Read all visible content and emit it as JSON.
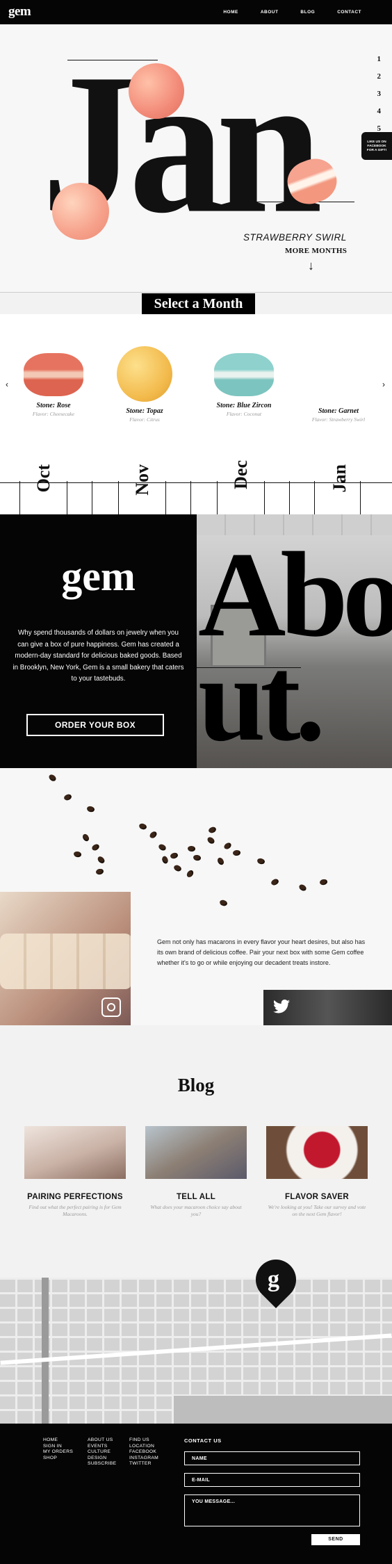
{
  "nav": {
    "logo": "gem",
    "links": [
      "HOME",
      "ABOUT",
      "BLOG",
      "CONTACT"
    ]
  },
  "hero": {
    "month": "Jan",
    "side_numbers": [
      "1",
      "2",
      "3",
      "4",
      "5"
    ],
    "gift_tab": [
      "LIKE US ON",
      "FACEBOOK",
      "FOR A GIFT!"
    ],
    "flavor": "STRAWBERRY SWIRL",
    "more": "MORE MONTHS",
    "arrow": "↓"
  },
  "select": {
    "heading": "Select a Month",
    "prev": "‹",
    "next": "›",
    "cards": [
      {
        "name": "Stone: Rose",
        "flavor": "Flavor: Cheesecake"
      },
      {
        "name": "Stone: Topaz",
        "flavor": "Flavor: Citrus"
      },
      {
        "name": "Stone: Blue Zircon",
        "flavor": "Flavor: Coconut"
      },
      {
        "name": "Stone: Garnet",
        "flavor": "Flavor: Strawberry Swirl"
      }
    ],
    "months": [
      "Oct",
      "Nov",
      "Dec",
      "Jan"
    ]
  },
  "about": {
    "logo": "gem",
    "text": "Why spend thousands of dollars on jewelry when you can give a box of pure happiness. Gem has created a modern-day standard for delicious baked goods. Based in Brooklyn, New York, Gem is a small bakery that caters to your tastebuds.",
    "button": "ORDER YOUR BOX",
    "big_line1": "Abo",
    "big_line2": "ut."
  },
  "coffee": {
    "text": "Gem not only has macarons in every flavor your heart desires, but also has its own brand of delicious coffee. Pair your next box with some Gem coffee whether it's to go or while enjoying our decadent treats instore."
  },
  "blog": {
    "heading": "Blog",
    "posts": [
      {
        "title": "PAIRING PERFECTIONS",
        "sub": "Find out what the perfect pairing is for Gem Macaroons."
      },
      {
        "title": "TELL ALL",
        "sub": "What does your macaroon choice say about you?"
      },
      {
        "title": "FLAVOR SAVER",
        "sub": "We're looking at you! Take our survey and vote on the next Gem flavor!"
      }
    ]
  },
  "map": {
    "pin_logo": "g"
  },
  "footer": {
    "col1": [
      "HOME",
      "SIGN IN",
      "MY ORDERS",
      "SHOP"
    ],
    "col2": [
      "ABOUT US",
      "EVENTS",
      "CULTURE",
      "DESIGN",
      "SUBSCRIBE"
    ],
    "col3": [
      "FIND US",
      "LOCATION",
      "FACEBOOK",
      "INSTAGRAM",
      "TWITTER"
    ],
    "contact_heading": "CONTACT US",
    "name_placeholder": "NAME",
    "email_placeholder": "E-MAIL",
    "message_placeholder": "YOU MESSAGE...",
    "send": "SEND"
  },
  "colors": {
    "black": "#050505",
    "rose": "#e9897a",
    "topaz": "#f0c060",
    "zircon": "#8fd0cc",
    "garnet": "#f6c2ad"
  }
}
